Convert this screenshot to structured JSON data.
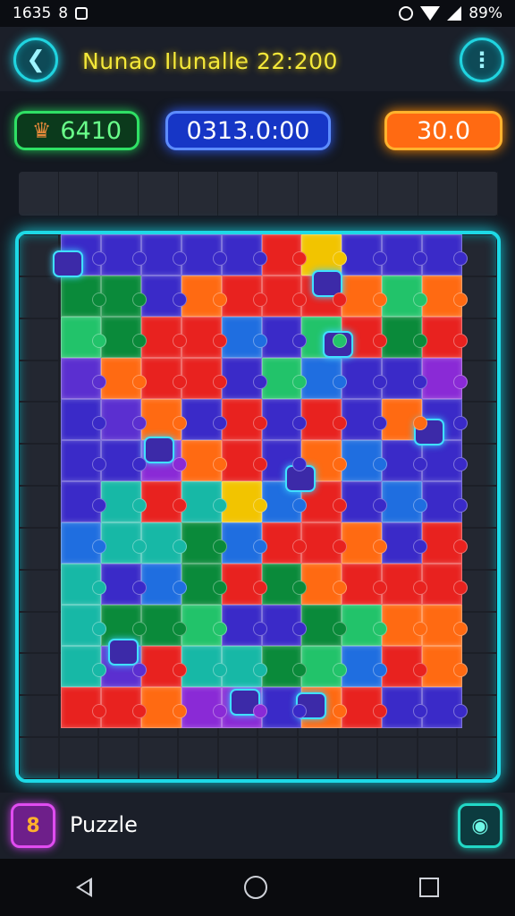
{
  "status_bar": {
    "time": "1635",
    "extra": "8",
    "battery": "89%"
  },
  "header": {
    "back_icon": "arrow-left-icon",
    "title": "Nunao Ilunalle 22:200",
    "menu_icon": "more-vertical-icon"
  },
  "stats": {
    "score": "6410",
    "timer": "0313.0:00",
    "coins": "30.0",
    "score_icon": "trophy-icon"
  },
  "bottom_bar": {
    "badge_icon": "puzzle-app-icon",
    "badge_text": "8",
    "label": "Puzzle",
    "camera_icon": "camera-icon"
  },
  "nav": {
    "back_icon": "triangle-back-icon",
    "home_icon": "circle-home-icon",
    "recents_icon": "square-recents-icon"
  },
  "colors": {
    "accent_cyan": "#1dd9e6",
    "title_yellow": "#f4e83a",
    "score_green": "#2fe065",
    "timer_blue": "#1636c6",
    "coin_orange": "#ff6a12",
    "tile_palette": [
      "#e8221f",
      "#ff6a12",
      "#f2c400",
      "#22c36a",
      "#0a8a3a",
      "#17b8a6",
      "#1f6ee0",
      "#3a2ac8",
      "#5b2fd0",
      "#8a2ad6"
    ]
  },
  "board": {
    "rows": [
      [
        "#3a2ac8",
        "#3a2ac8",
        "#3a2ac8",
        "#3a2ac8",
        "#3a2ac8",
        "#e8221f",
        "#f2c400",
        "#3a2ac8",
        "#3a2ac8",
        "#3a2ac8"
      ],
      [
        "#0a8a3a",
        "#0a8a3a",
        "#3a2ac8",
        "#ff6a12",
        "#e8221f",
        "#e8221f",
        "#e8221f",
        "#ff6a12",
        "#22c36a",
        "#ff6a12"
      ],
      [
        "#22c36a",
        "#0a8a3a",
        "#e8221f",
        "#e8221f",
        "#1f6ee0",
        "#3a2ac8",
        "#22c36a",
        "#e8221f",
        "#0a8a3a",
        "#e8221f"
      ],
      [
        "#5b2fd0",
        "#ff6a12",
        "#e8221f",
        "#e8221f",
        "#3a2ac8",
        "#22c36a",
        "#1f6ee0",
        "#3a2ac8",
        "#3a2ac8",
        "#8a2ad6"
      ],
      [
        "#3a2ac8",
        "#5b2fd0",
        "#ff6a12",
        "#3a2ac8",
        "#e8221f",
        "#3a2ac8",
        "#e8221f",
        "#3a2ac8",
        "#ff6a12",
        "#3a2ac8"
      ],
      [
        "#3a2ac8",
        "#3a2ac8",
        "#8a2ad6",
        "#ff6a12",
        "#e8221f",
        "#3a2ac8",
        "#ff6a12",
        "#1f6ee0",
        "#3a2ac8",
        "#3a2ac8"
      ],
      [
        "#3a2ac8",
        "#17b8a6",
        "#e8221f",
        "#17b8a6",
        "#f2c400",
        "#1f6ee0",
        "#e8221f",
        "#3a2ac8",
        "#1f6ee0",
        "#3a2ac8"
      ],
      [
        "#1f6ee0",
        "#17b8a6",
        "#17b8a6",
        "#0a8a3a",
        "#1f6ee0",
        "#e8221f",
        "#e8221f",
        "#ff6a12",
        "#3a2ac8",
        "#e8221f"
      ],
      [
        "#17b8a6",
        "#3a2ac8",
        "#1f6ee0",
        "#0a8a3a",
        "#e8221f",
        "#0a8a3a",
        "#ff6a12",
        "#e8221f",
        "#e8221f",
        "#e8221f"
      ],
      [
        "#17b8a6",
        "#0a8a3a",
        "#0a8a3a",
        "#22c36a",
        "#3a2ac8",
        "#3a2ac8",
        "#0a8a3a",
        "#22c36a",
        "#ff6a12",
        "#ff6a12"
      ],
      [
        "#17b8a6",
        "#5b2fd0",
        "#e8221f",
        "#17b8a6",
        "#17b8a6",
        "#0a8a3a",
        "#22c36a",
        "#1f6ee0",
        "#e8221f",
        "#ff6a12"
      ],
      [
        "#e8221f",
        "#e8221f",
        "#ff6a12",
        "#8a2ad6",
        "#8a2ad6",
        "#3a2ac8",
        "#ff6a12",
        "#e8221f",
        "#3a2ac8",
        "#3a2ac8"
      ]
    ]
  }
}
